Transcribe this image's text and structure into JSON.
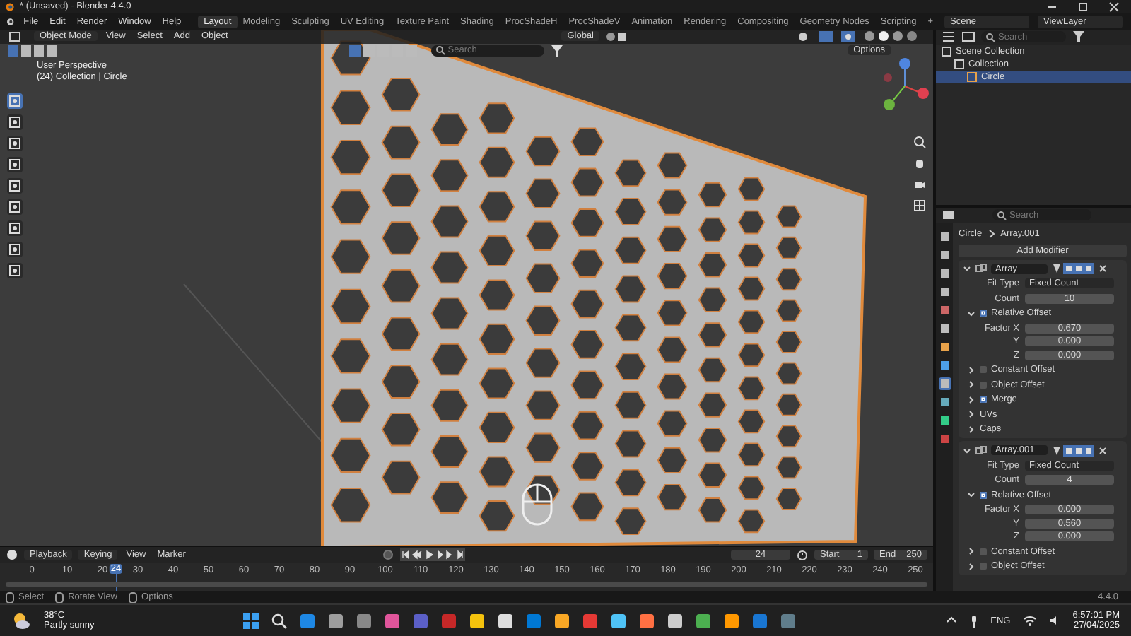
{
  "window": {
    "title": "* (Unsaved) - Blender 4.4.0"
  },
  "menu": [
    "File",
    "Edit",
    "Render",
    "Window",
    "Help"
  ],
  "workspaces": [
    {
      "label": "Layout",
      "selected": true
    },
    {
      "label": "Modeling",
      "selected": false
    },
    {
      "label": "Sculpting",
      "selected": false
    },
    {
      "label": "UV Editing",
      "selected": false
    },
    {
      "label": "Texture Paint",
      "selected": false
    },
    {
      "label": "Shading",
      "selected": false
    },
    {
      "label": "ProcShadeH",
      "selected": false
    },
    {
      "label": "ProcShadeV",
      "selected": false
    },
    {
      "label": "Animation",
      "selected": false
    },
    {
      "label": "Rendering",
      "selected": false
    },
    {
      "label": "Compositing",
      "selected": false
    },
    {
      "label": "Geometry Nodes",
      "selected": false
    },
    {
      "label": "Scripting",
      "selected": false
    }
  ],
  "add_workspace": "+",
  "scene": "Scene",
  "view_layer": "ViewLayer",
  "viewport": {
    "mode": "Object Mode",
    "menus": [
      "View",
      "Select",
      "Add",
      "Object"
    ],
    "orientation": "Global",
    "search_placeholder": "Search",
    "options": "Options",
    "view_name": "User Perspective",
    "context": "(24) Collection | Circle"
  },
  "outliner": {
    "search_placeholder": "Search",
    "tree": [
      {
        "label": "Scene Collection",
        "selected": false,
        "children": [
          {
            "label": "Collection",
            "selected": false,
            "children": [
              {
                "label": "Circle",
                "selected": true
              }
            ]
          }
        ]
      }
    ]
  },
  "properties": {
    "search_placeholder": "Search",
    "breadcrumb": [
      "Circle",
      "Array.001"
    ],
    "add_modifier": "Add Modifier",
    "modifiers": [
      {
        "name": "Array",
        "fit_type_label": "Fit Type",
        "fit_type": "Fixed Count",
        "count_label": "Count",
        "count": "10",
        "relative_offset": {
          "label": "Relative Offset",
          "checked": true
        },
        "factors": [
          {
            "label": "Factor X",
            "value": "0.670"
          },
          {
            "label": "Y",
            "value": "0.000"
          },
          {
            "label": "Z",
            "value": "0.000"
          }
        ],
        "subpanels": [
          {
            "kind": "checkbox",
            "label": "Constant Offset",
            "checked": false
          },
          {
            "kind": "checkbox",
            "label": "Object Offset",
            "checked": false
          },
          {
            "kind": "checkbox",
            "label": "Merge",
            "checked": true
          },
          {
            "kind": "plain",
            "label": "UVs"
          },
          {
            "kind": "plain",
            "label": "Caps"
          }
        ]
      },
      {
        "name": "Array.001",
        "fit_type_label": "Fit Type",
        "fit_type": "Fixed Count",
        "count_label": "Count",
        "count": "4",
        "relative_offset": {
          "label": "Relative Offset",
          "checked": true
        },
        "factors": [
          {
            "label": "Factor X",
            "value": "0.000"
          },
          {
            "label": "Y",
            "value": "0.560"
          },
          {
            "label": "Z",
            "value": "0.000"
          }
        ],
        "subpanels": [
          {
            "kind": "checkbox",
            "label": "Constant Offset",
            "checked": false
          },
          {
            "kind": "checkbox",
            "label": "Object Offset",
            "checked": false
          }
        ]
      }
    ]
  },
  "timeline": {
    "menus": [
      "Playback",
      "Keying",
      "View",
      "Marker"
    ],
    "current_frame": "24",
    "playhead_frame": "24",
    "start_label": "Start",
    "start": "1",
    "end_label": "End",
    "end": "250",
    "ticks": [
      "0",
      "10",
      "20",
      "30",
      "40",
      "50",
      "60",
      "70",
      "80",
      "90",
      "100",
      "110",
      "120",
      "130",
      "140",
      "150",
      "160",
      "170",
      "180",
      "190",
      "200",
      "210",
      "220",
      "230",
      "240",
      "250"
    ]
  },
  "status_bar": {
    "hints": [
      "Select",
      "Rotate View",
      "Options"
    ],
    "version": "4.4.0"
  },
  "taskbar": {
    "temperature": "38°C",
    "weather": "Partly sunny",
    "language": "ENG",
    "time": "6:57:01 PM",
    "date": "27/04/2025"
  }
}
